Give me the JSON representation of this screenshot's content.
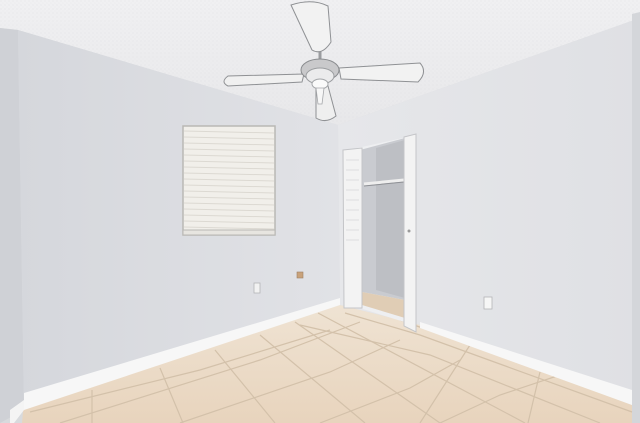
{
  "scene": {
    "description_visible_text": [],
    "colors": {
      "ceiling": "#eeeef0",
      "left_wall": "#dcdee2",
      "right_wall": "#e4e5e8",
      "floor_tile": "#ecdcc9",
      "grout": "#cdbba5",
      "baseboard": "#f8f8f8",
      "closet_interior": "#c9cbd0",
      "door": "#f3f3f3",
      "blind": "#f1efea"
    },
    "icons": [
      "ceiling-fan-icon",
      "window-blinds",
      "bifold-closet-door",
      "wall-outlet-icon"
    ]
  }
}
